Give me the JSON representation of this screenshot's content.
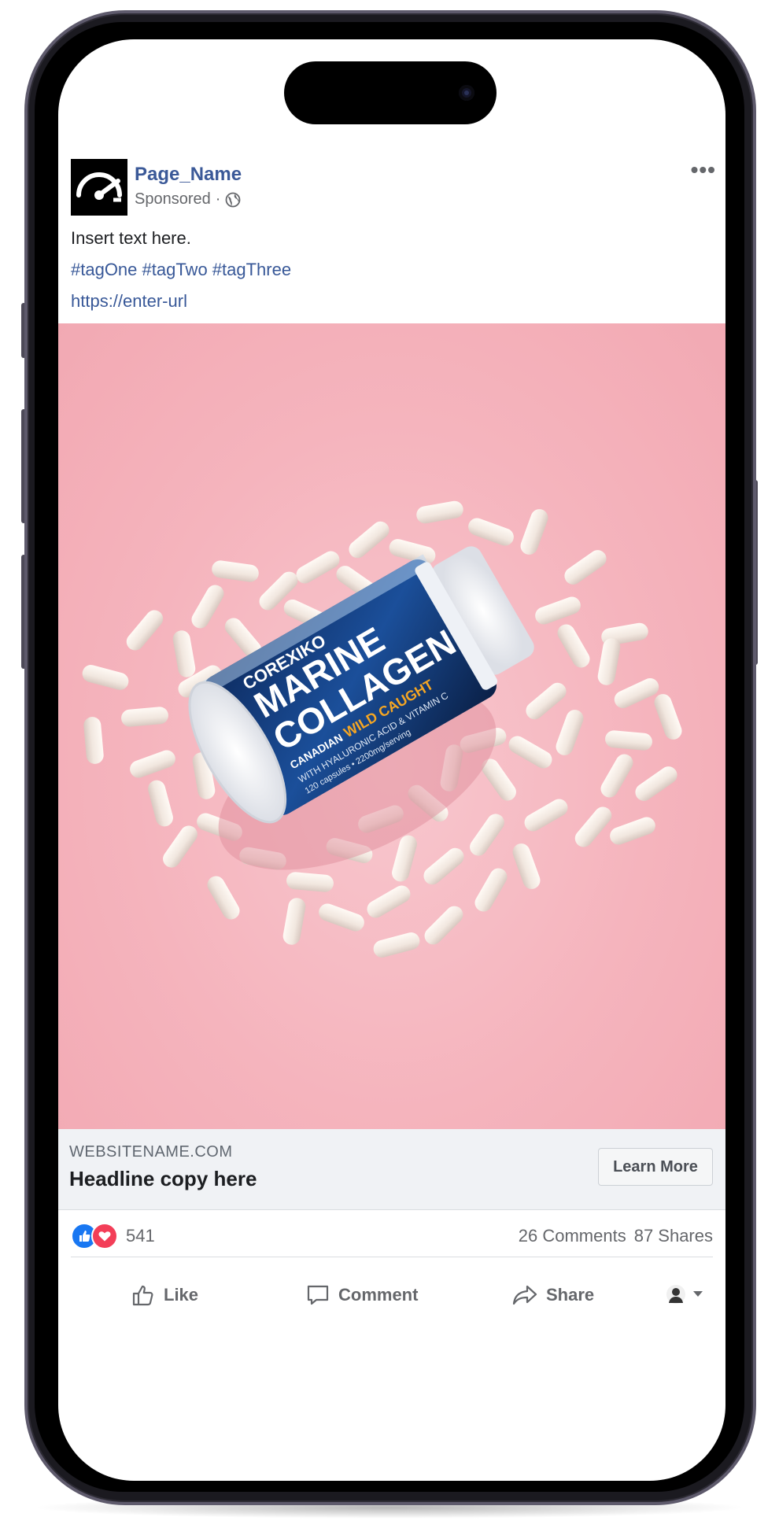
{
  "post": {
    "page_name": "Page_Name",
    "sponsored": "Sponsored",
    "separator": "·",
    "more_label": "•••",
    "text": "Insert text here.",
    "tags": "#tagOne #tagTwo #tagThree",
    "url": "https://enter-url"
  },
  "ad": {
    "product_brand": "COREXIKO",
    "product_name_line1": "MARINE",
    "product_name_line2": "COLLAGEN",
    "product_tag1": "CANADIAN",
    "product_tag2": "WILD CAUGHT",
    "product_sub": "WITH HYALURONIC ACID & VITAMIN C",
    "product_caps": "120 capsules • 2200mg/serving"
  },
  "link_card": {
    "site_name": "WEBSITENAME.COM",
    "headline": "Headline copy here",
    "cta_label": "Learn More"
  },
  "engagement": {
    "reaction_count": "541",
    "comments": "26 Comments",
    "shares": "87 Shares"
  },
  "actions": {
    "like": "Like",
    "comment": "Comment",
    "share": "Share"
  },
  "colors": {
    "link_blue": "#385898",
    "page_name_blue": "#3b5998",
    "like_blue": "#1877f2",
    "love_red": "#f33e58",
    "ad_background": "#f5b4bd",
    "bottle_blue": "#1b3d7a"
  },
  "icons": [
    "speedometer-logo-icon",
    "globe-icon",
    "more-icon",
    "like-reaction-icon",
    "love-reaction-icon",
    "thumbs-up-icon",
    "comment-icon",
    "share-icon",
    "profile-avatar-icon",
    "caret-down-icon"
  ]
}
